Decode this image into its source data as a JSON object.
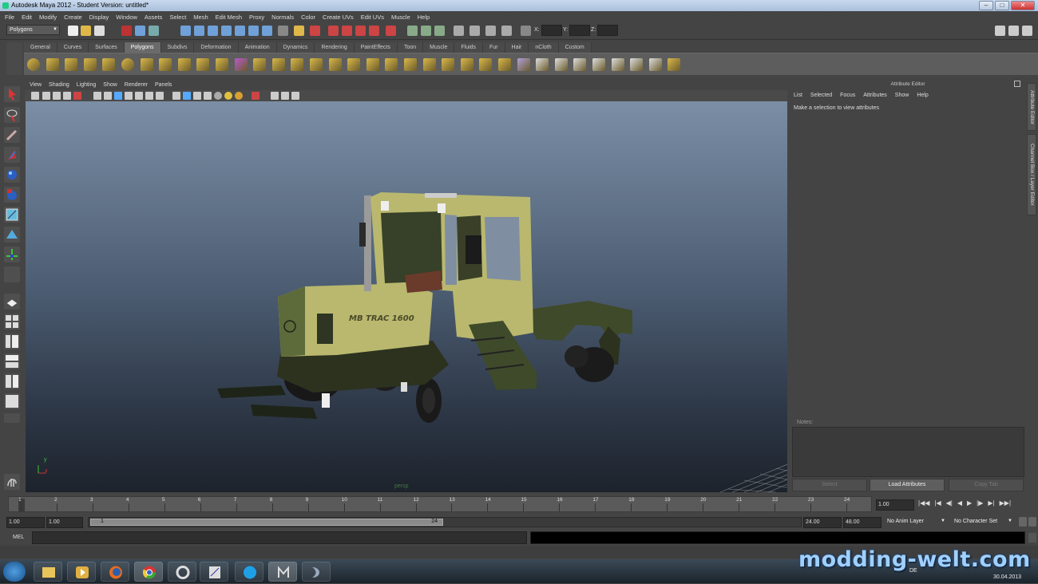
{
  "window": {
    "title": "Autodesk Maya 2012 - Student Version: untitled*",
    "minimize": "–",
    "maximize": "□",
    "close": "✕"
  },
  "menubar": [
    "File",
    "Edit",
    "Modify",
    "Create",
    "Display",
    "Window",
    "Assets",
    "Select",
    "Mesh",
    "Edit Mesh",
    "Proxy",
    "Normals",
    "Color",
    "Create UVs",
    "Edit UVs",
    "Muscle",
    "Help"
  ],
  "statusline": {
    "mode": "Polygons",
    "x_label": "X:",
    "y_label": "Y:",
    "z_label": "Z:"
  },
  "shelf_tabs": [
    "General",
    "Curves",
    "Surfaces",
    "Polygons",
    "Subdivs",
    "Deformation",
    "Animation",
    "Dynamics",
    "Rendering",
    "PaintEffects",
    "Toon",
    "Muscle",
    "Fluids",
    "Fur",
    "Hair",
    "nCloth",
    "Custom"
  ],
  "active_shelf_tab": "Polygons",
  "panel_menu": [
    "View",
    "Shading",
    "Lighting",
    "Show",
    "Renderer",
    "Panels"
  ],
  "viewport": {
    "camera": "persp",
    "axis_x": "x",
    "axis_y": "y",
    "model_badge": "MB TRAC 1600"
  },
  "attribute_editor": {
    "title": "Attribute Editor",
    "menu": [
      "List",
      "Selected",
      "Focus",
      "Attributes",
      "Show",
      "Help"
    ],
    "message": "Make a selection to view attributes",
    "notes_label": "Notes:",
    "buttons": [
      "Select",
      "Load Attributes",
      "Copy Tab"
    ]
  },
  "side_tabs": [
    "Attribute Editor",
    "Channel Box / Layer Editor"
  ],
  "timeslider": {
    "ticks": [
      "1",
      "2",
      "3",
      "4",
      "5",
      "6",
      "7",
      "8",
      "9",
      "10",
      "11",
      "12",
      "13",
      "14",
      "15",
      "16",
      "17",
      "18",
      "19",
      "20",
      "21",
      "22",
      "23",
      "24"
    ],
    "current_frame": "1.00"
  },
  "range": {
    "start": "1.00",
    "range_start": "1.00",
    "range_slider_start": "1",
    "range_slider_end": "24",
    "range_end": "24.00",
    "end": "48.00",
    "anim_layer": "No Anim Layer",
    "character_set": "No Character Set"
  },
  "cmdline": {
    "label": "MEL"
  },
  "taskbar": {
    "lang": "DE",
    "date": "30.04.2013"
  },
  "watermark": "modding-welt.com",
  "colors": {
    "tractor_body": "#b9b86e",
    "tractor_dark": "#3f4a2a",
    "viewport_top": "#7b8ea5",
    "viewport_bottom": "#1d232c",
    "watermark": "#9fd0ff"
  }
}
